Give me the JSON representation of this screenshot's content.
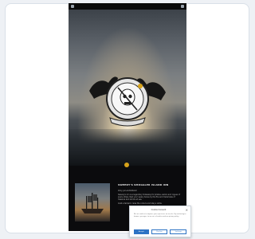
{
  "page": {
    "brand_gold": "#d6a21a",
    "background": "#0b0b0d"
  },
  "hero": {
    "emblem_icon": "skull-ship-emblem-icon"
  },
  "content": {
    "heading": "SWEENY'S SMUGGLER ISLAND INN",
    "paragraphs": [
      "Ahoy ye Landlubbers!",
      "Sweeny's Inn is a legendary hideaway for pirates, sailors and rogues of every stripe. Rest your weary bones by the fire and trade tales of treasure and storms at sea.",
      "Grab a tankard, raise the colours and stay a while."
    ]
  },
  "cookie": {
    "title": "Cookie Consent",
    "text": "We use cookies to improve your experience on our site. By continuing to browse, you agree to our use of cookies and our privacy policy.",
    "accept_label": "Accept",
    "decline_label": "Decline",
    "settings_label": "Settings"
  }
}
